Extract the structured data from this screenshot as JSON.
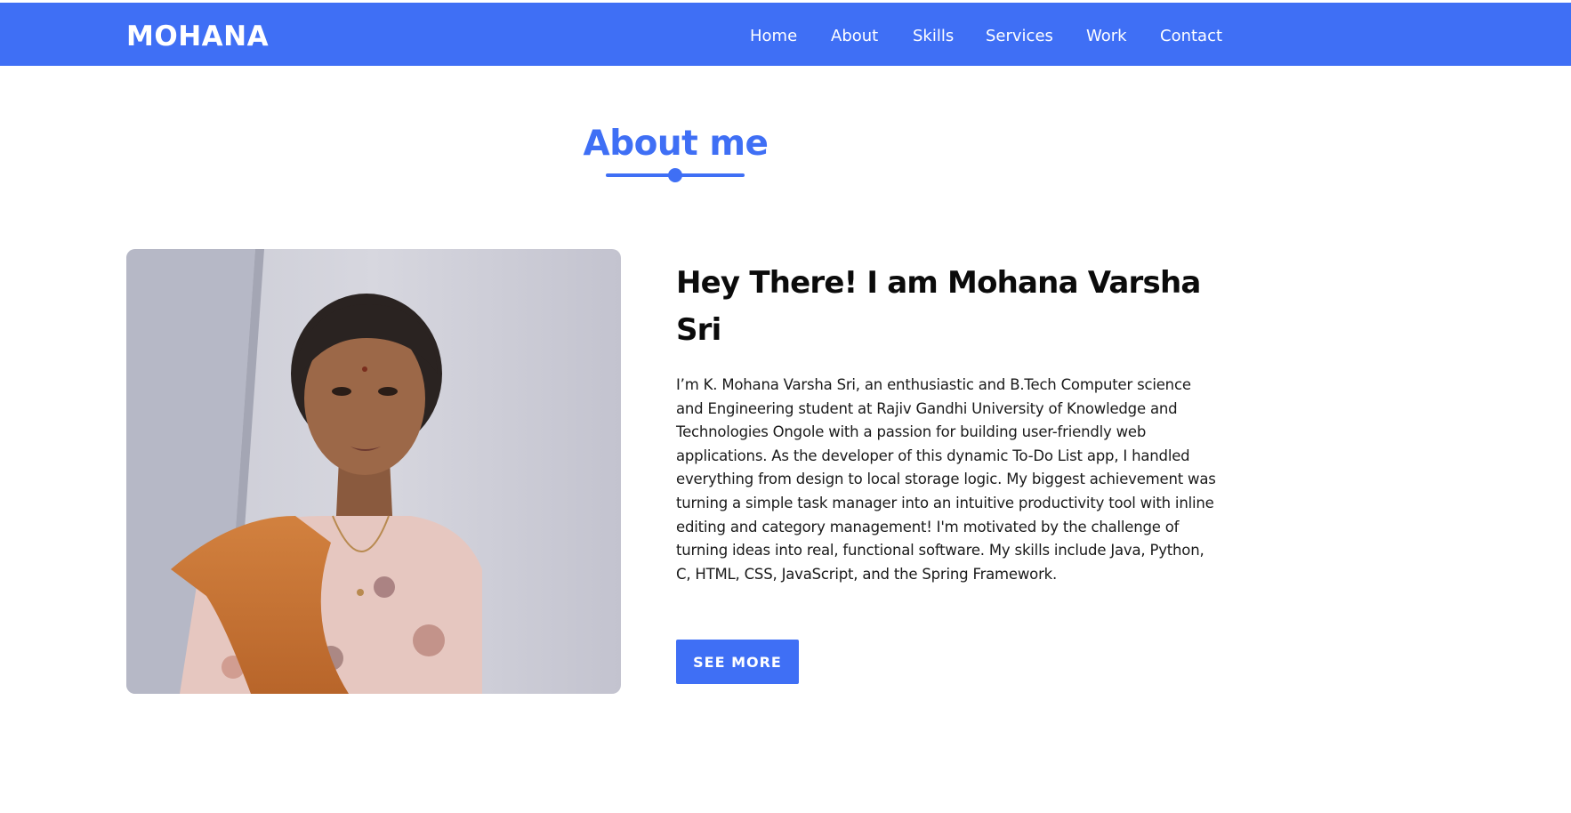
{
  "navbar": {
    "brand": "MOHANA",
    "links": [
      "Home",
      "About",
      "Skills",
      "Services",
      "Work",
      "Contact"
    ]
  },
  "about": {
    "section_title": "About me",
    "heading": "Hey There! I am Mohana Varsha Sri",
    "paragraph": "I’m K. Mohana Varsha Sri, an enthusiastic and B.Tech Computer science and Engineering student at Rajiv Gandhi University of Knowledge and Technologies Ongole with a passion for building user-friendly web applications. As the developer of this dynamic To-Do List app, I handled everything from design to local storage logic. My biggest achievement was turning a simple task manager into an intuitive productivity tool with inline editing and category management! I'm motivated by the challenge of turning ideas into real, functional software. My skills include Java, Python, C, HTML, CSS, JavaScript, and the Spring Framework.",
    "button_label": "SEE MORE"
  },
  "colors": {
    "accent": "#3f6ff5",
    "heading_text": "#0b0b0b",
    "body_text": "#1a1a1a"
  }
}
